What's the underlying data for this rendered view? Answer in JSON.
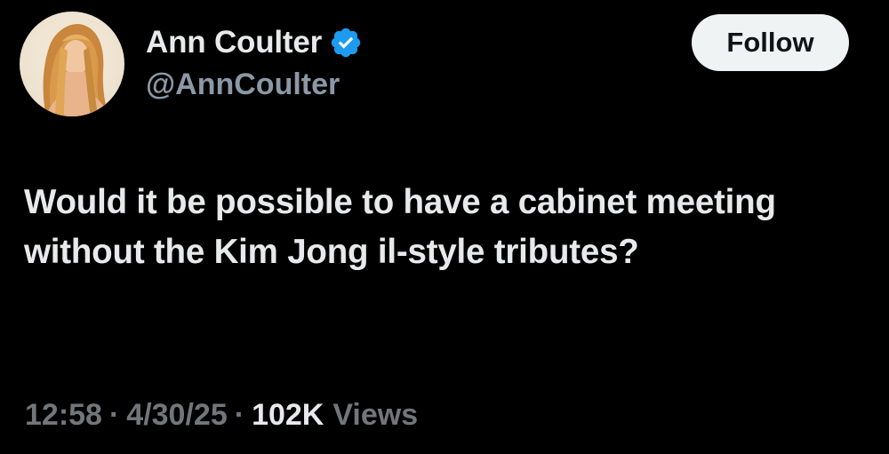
{
  "author": {
    "display_name": "Ann Coulter",
    "handle": "@AnnCoulter",
    "verified_icon": "verified-badge-icon",
    "verified_color": "#1d9bf0"
  },
  "follow_button": {
    "label": "Follow"
  },
  "tweet": {
    "text": "Would it be possible to have a cabinet meeting without the Kim Jong il-style tributes?"
  },
  "meta": {
    "time": "12:58",
    "separator": "·",
    "date": "4/30/25",
    "views_count": "102K",
    "views_label": "Views"
  },
  "colors": {
    "background": "#000000",
    "primary_text": "#e7e9ea",
    "secondary_text": "#71767b",
    "button_bg": "#eff3f4"
  }
}
